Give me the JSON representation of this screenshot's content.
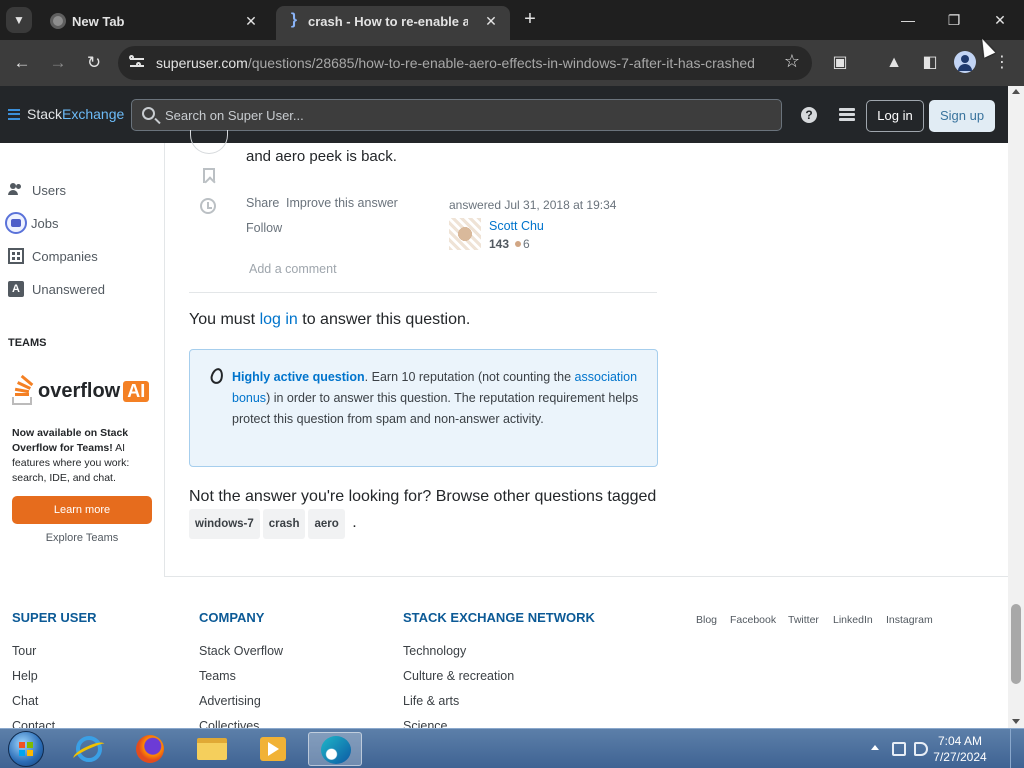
{
  "browser": {
    "tabs": [
      {
        "title": "New Tab",
        "active": false
      },
      {
        "title": "crash - How to re-enable aero",
        "active": true
      }
    ],
    "new_tab_label": "+",
    "url_domain": "superuser.com",
    "url_path": "/questions/28685/how-to-re-enable-aero-effects-in-windows-7-after-it-has-crashed",
    "icons": [
      "tab-search-icon",
      "back-icon",
      "forward-icon",
      "reload-icon",
      "site-info-icon",
      "bookmark-star-icon",
      "extensions-icon",
      "labs-icon",
      "side-panel-icon",
      "profile-icon",
      "menu-icon",
      "minimize-icon",
      "restore-icon",
      "close-icon"
    ]
  },
  "se_header": {
    "logo_stack": "Stack",
    "logo_exchange": "Exchange",
    "search_placeholder": "Search on Super User...",
    "login": "Log in",
    "signup": "Sign up"
  },
  "sidebar": {
    "items": [
      {
        "label": "Users",
        "icon": "users-icon"
      },
      {
        "label": "Jobs",
        "icon": "jobs-icon"
      },
      {
        "label": "Companies",
        "icon": "companies-icon"
      },
      {
        "label": "Unanswered",
        "icon": "unanswered-icon"
      }
    ],
    "teams_heading": "TEAMS",
    "overflow_word": "overflow",
    "ai_word": "AI",
    "promo_bold": "Now available on Stack Overflow for Teams!",
    "promo_rest": " AI features where you work: search, IDE, and chat.",
    "learn_more": "Learn more",
    "explore_teams": "Explore Teams"
  },
  "answer": {
    "text_tail": "and aero peek is back.",
    "share": "Share",
    "improve": "Improve this answer",
    "follow": "Follow",
    "answered": "answered Jul 31, 2018 at 19:34",
    "user_name": "Scott Chu",
    "reputation": "143",
    "bronze_badges": "6",
    "add_comment": "Add a comment"
  },
  "login_prompt": {
    "before": "You must ",
    "link": "log in",
    "after": " to answer this question."
  },
  "notice": {
    "strong": "Highly active question",
    "text1": ". Earn 10 reputation (not counting the ",
    "link": "association bonus",
    "text2": ") in order to answer this question. The reputation requirement helps protect this question from spam and non-answer activity."
  },
  "browse": {
    "text": "Not the answer you're looking for? Browse other questions tagged ",
    "tags": [
      "windows-7",
      "crash",
      "aero"
    ],
    "end": "."
  },
  "footer": {
    "col1": {
      "heading": "SUPER USER",
      "links": [
        "Tour",
        "Help",
        "Chat",
        "Contact"
      ]
    },
    "col2": {
      "heading": "COMPANY",
      "links": [
        "Stack Overflow",
        "Teams",
        "Advertising",
        "Collectives"
      ]
    },
    "col3": {
      "heading": "STACK EXCHANGE NETWORK",
      "links": [
        "Technology",
        "Culture & recreation",
        "Life & arts",
        "Science"
      ]
    },
    "social": [
      "Blog",
      "Facebook",
      "Twitter",
      "LinkedIn",
      "Instagram"
    ]
  },
  "taskbar": {
    "time": "7:04 AM",
    "date": "7/27/2024",
    "apps": [
      "internet-explorer-icon",
      "firefox-icon",
      "file-explorer-icon",
      "media-player-icon",
      "edge-icon"
    ]
  },
  "colors": {
    "link": "#0074cc",
    "notice_bg": "#ebf4fb",
    "learn_more_bg": "#e66c1d",
    "footer_heading": "#0c5a96"
  }
}
